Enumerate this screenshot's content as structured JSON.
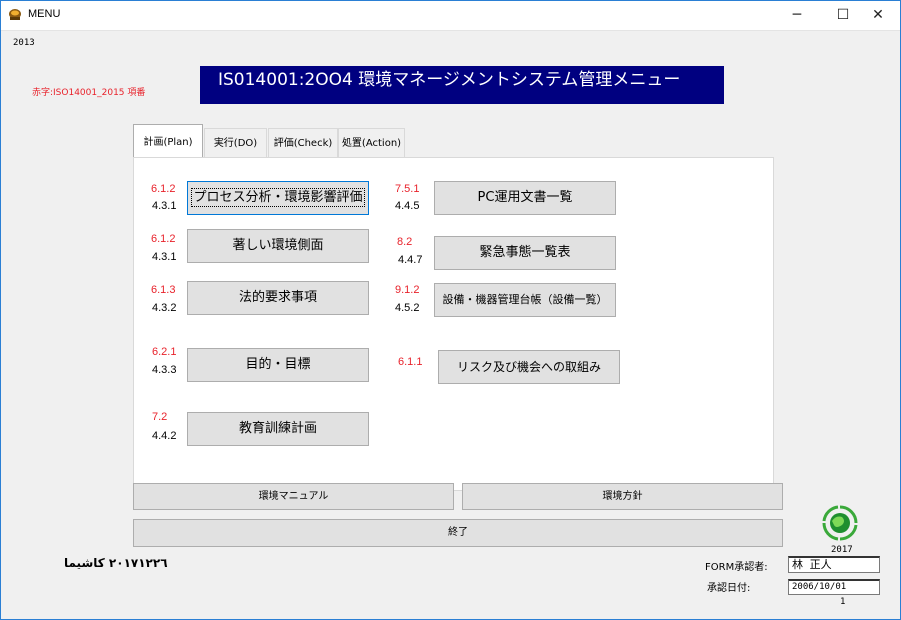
{
  "window": {
    "title": "MENU",
    "minimize": "─",
    "maximize": "☐",
    "close": "✕"
  },
  "year_top": "2013",
  "red_note": "赤字:ISO14001_2015 項番",
  "banner": "IS014001:2OO4 環境マネージメントシステム管理メニュー",
  "tabs": [
    {
      "label": "計画(Plan)",
      "active": true
    },
    {
      "label": "実行(DO)"
    },
    {
      "label": "評価(Check)"
    },
    {
      "label": "処置(Action)"
    }
  ],
  "left_items": [
    {
      "red": "6.1.2",
      "black": "4.3.1",
      "label": "プロセス分析・環境影響評価"
    },
    {
      "red": "6.1.2",
      "black": "4.3.1",
      "label": "著しい環境側面"
    },
    {
      "red": "6.1.3",
      "black": "4.3.2",
      "label": "法的要求事項"
    },
    {
      "red": "6.2.1",
      "black": "4.3.3",
      "label": "目的・目標"
    },
    {
      "red": "7.2",
      "black": "4.4.2",
      "label": "教育訓練計画"
    }
  ],
  "right_items": [
    {
      "red": "7.5.1",
      "black": "4.4.5",
      "label": "PC運用文書一覧"
    },
    {
      "red": "8.2",
      "black": "4.4.7",
      "label": "緊急事態一覧表"
    },
    {
      "red": "9.1.2",
      "black": "4.5.2",
      "label": "設備・機器管理台帳（設備一覧）"
    },
    {
      "red": "6.1.1",
      "black": "",
      "label": "リスク及び機会への取組み"
    }
  ],
  "bottom": {
    "manual": "環境マニュアル",
    "policy": "環境方針",
    "exit": "終了"
  },
  "arabic_text": "٢٠١٧١٢٢٦ كاشيما",
  "logo_year": "2017",
  "approver_label": "FORM承認者:",
  "approver_value": "林 正人",
  "date_label": "承認日付:",
  "date_value": "2006/10/01",
  "page_number": "1"
}
